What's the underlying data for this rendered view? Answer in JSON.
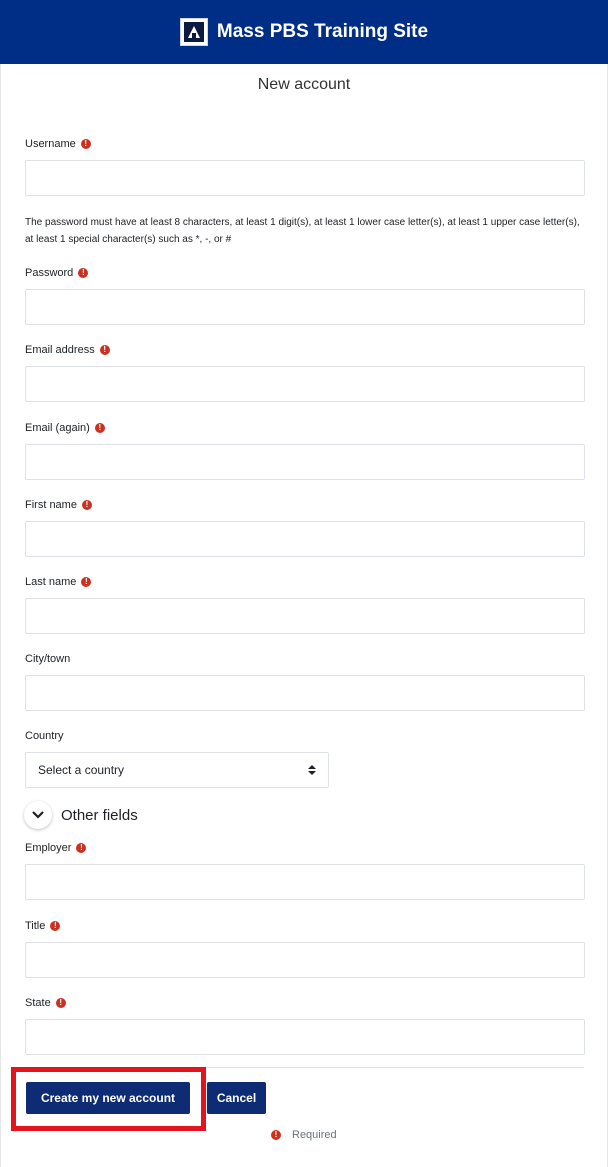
{
  "header": {
    "site_name": "Mass PBS Training Site",
    "logo_icon": "mass-pbs-logo-icon"
  },
  "page": {
    "title": "New account"
  },
  "form": {
    "username": {
      "label": "Username",
      "value": ""
    },
    "password_policy": "The password must have at least 8 characters, at least 1 digit(s), at least 1 lower case letter(s), at least 1 upper case letter(s), at least 1 special character(s) such as *, -, or #",
    "password": {
      "label": "Password",
      "value": ""
    },
    "email": {
      "label": "Email address",
      "value": ""
    },
    "email_again": {
      "label": "Email (again)",
      "value": ""
    },
    "first_name": {
      "label": "First name",
      "value": ""
    },
    "last_name": {
      "label": "Last name",
      "value": ""
    },
    "city": {
      "label": "City/town",
      "value": ""
    },
    "country": {
      "label": "Country",
      "selected": "Select a country"
    },
    "other_fields": {
      "title": "Other fields"
    },
    "employer": {
      "label": "Employer",
      "value": ""
    },
    "title_field": {
      "label": "Title",
      "value": ""
    },
    "state": {
      "label": "State",
      "value": ""
    }
  },
  "buttons": {
    "create": "Create my new account",
    "cancel": "Cancel"
  },
  "required_note": "Required",
  "colors": {
    "header_bg": "#002d85",
    "button_bg": "#0e2c74",
    "required_icon": "#ca3120",
    "highlight": "#e3141d"
  }
}
